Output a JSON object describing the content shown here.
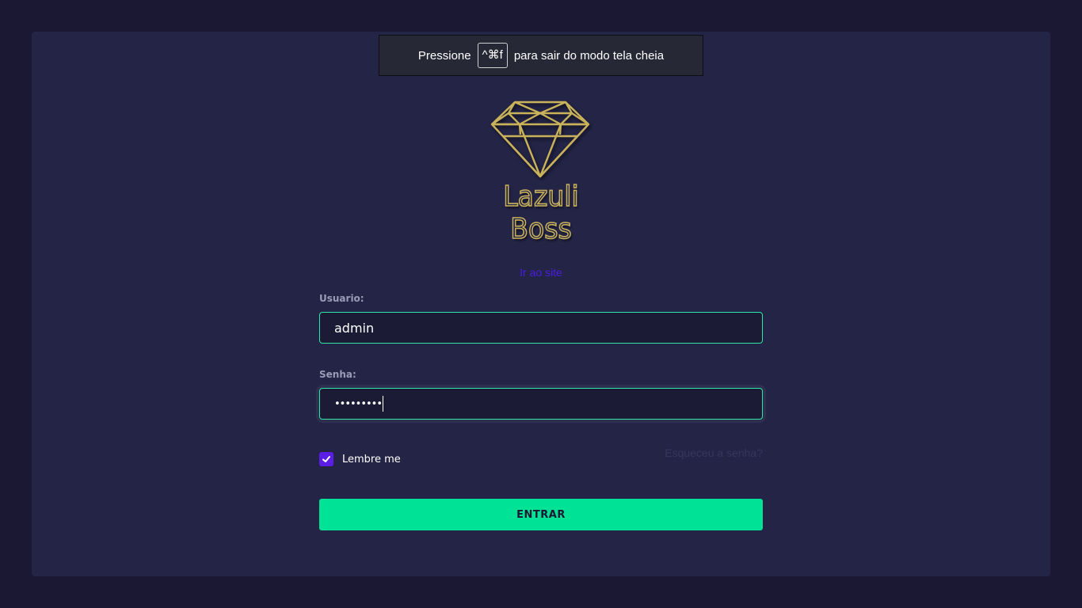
{
  "fullscreen_banner": {
    "prefix": "Pressione",
    "shortcut": "^⌘f",
    "suffix": "para sair do modo tela cheia"
  },
  "logo": {
    "text": "Lazuli Boss",
    "color": "#c9b25a"
  },
  "site_link": "Ir ao site",
  "form": {
    "username_label": "Usuario:",
    "username_value": "admin",
    "password_label": "Senha:",
    "password_value": "•••••••••",
    "remember_label": "Lembre me",
    "remember_checked": true,
    "forgot_label": "Esqueceu a senha?",
    "submit_label": "ENTRAR"
  },
  "colors": {
    "background": "#1a1833",
    "panel": "#242447",
    "accent": "#00e396",
    "link": "#4a1ee0",
    "checkbox": "#5a1ee6"
  }
}
